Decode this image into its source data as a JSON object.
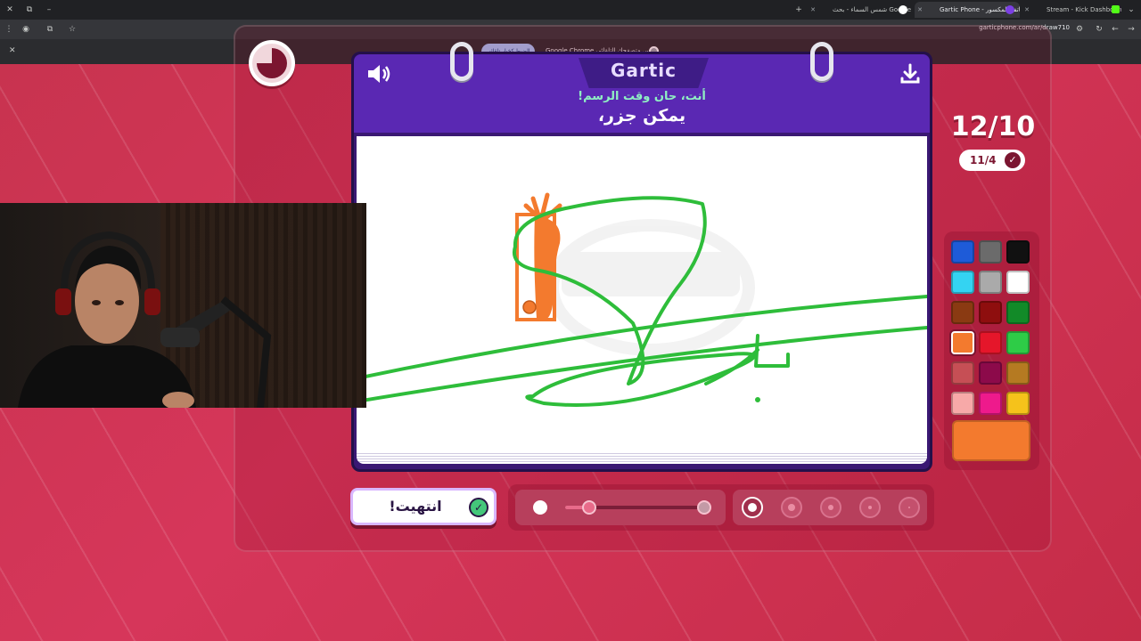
{
  "browser": {
    "tabs": [
      {
        "title": "Stream - Kick Dashboard",
        "icon_color": "#53fc18"
      },
      {
        "title": "Gartic Phone - الهاتف المكسور",
        "icon_color": "#7b3fe4"
      },
      {
        "title": "شمس السماء - بحث Google",
        "icon_color": "#ffffff"
      }
    ],
    "url": "garticphone.com/ar/draw710",
    "infobar": {
      "message": "Google Chrome ليس متصفحك التلقائي.",
      "button": "الضبط كخيار تلقائي"
    }
  },
  "game": {
    "logo": "Gartic",
    "prompt_small": "أنت، حان وقت الرسم!",
    "prompt_big": "يمكن جزر،",
    "round": "12/10",
    "done_count": "11/4",
    "done_button": "انتهيت!",
    "selected_color": "#f37a2e",
    "palette": [
      [
        "#1e5bd8",
        "#6b6b6b",
        "#111111"
      ],
      [
        "#34d3f2",
        "#aaaaaa",
        "#ffffff"
      ],
      [
        "#8a3a12",
        "#8e0e0e",
        "#128a28"
      ],
      [
        "#f37a2e",
        "#e5162a",
        "#2ecc47"
      ],
      [
        "#c64f55",
        "#8c0a4a",
        "#b57a22"
      ],
      [
        "#f7a9a8",
        "#ee1a8c",
        "#f5c21b"
      ]
    ],
    "brush_sizes": [
      {
        "name": "brush-size-xl",
        "selected": true
      },
      {
        "name": "brush-size-lg",
        "selected": false
      },
      {
        "name": "brush-size-md",
        "selected": false
      },
      {
        "name": "brush-size-sm",
        "selected": false
      },
      {
        "name": "brush-size-xs",
        "selected": false
      }
    ],
    "stroke_color": "#2ebd3a",
    "carrot_color": "#f37a2e",
    "opacity_level": 0.18
  },
  "icons": {
    "sound": "speaker-icon",
    "download": "download-icon",
    "timer": "timer-icon",
    "redo": "redo-icon",
    "undo": "undo-icon"
  }
}
